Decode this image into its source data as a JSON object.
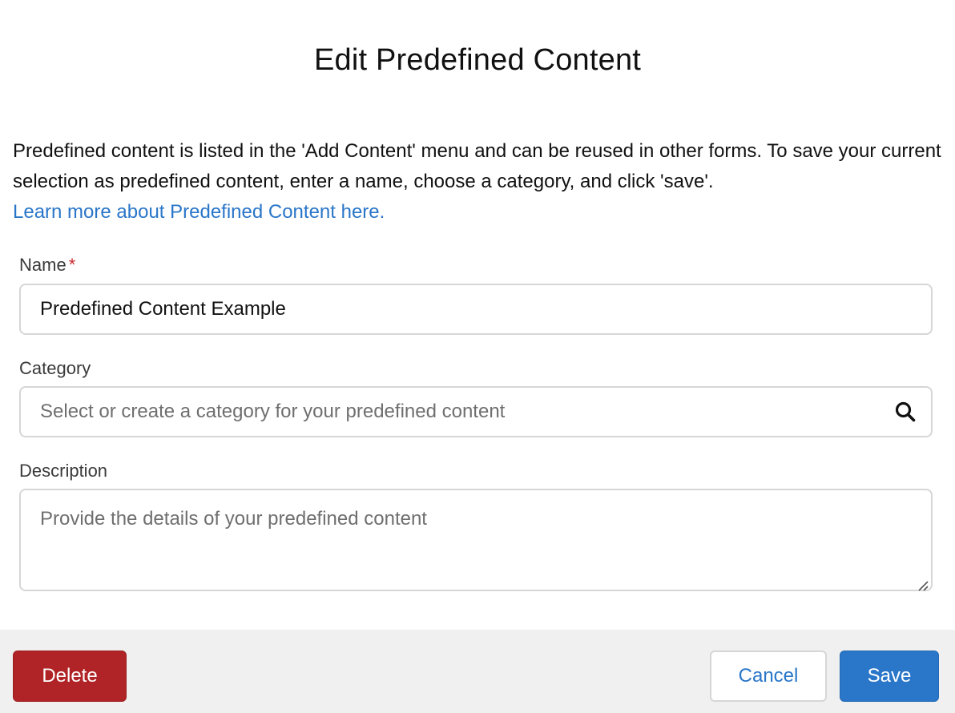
{
  "dialog": {
    "title": "Edit Predefined Content",
    "intro_text": "Predefined content is listed in the 'Add Content' menu and can be reused in other forms. To save your current selection as predefined content, enter a name, choose a category, and click 'save'.",
    "learn_more_link": "Learn more about Predefined Content here."
  },
  "form": {
    "name": {
      "label": "Name",
      "required_marker": "*",
      "value": "Predefined Content Example"
    },
    "category": {
      "label": "Category",
      "placeholder": "Select or create a category for your predefined content",
      "icon": "search-icon"
    },
    "description": {
      "label": "Description",
      "placeholder": "Provide the details of your predefined content"
    }
  },
  "footer": {
    "delete_label": "Delete",
    "cancel_label": "Cancel",
    "save_label": "Save"
  },
  "colors": {
    "link": "#2a76c9",
    "primary": "#2a76c9",
    "danger": "#b02427",
    "required": "#c7282d",
    "footer_bg": "#f0f0f0"
  }
}
